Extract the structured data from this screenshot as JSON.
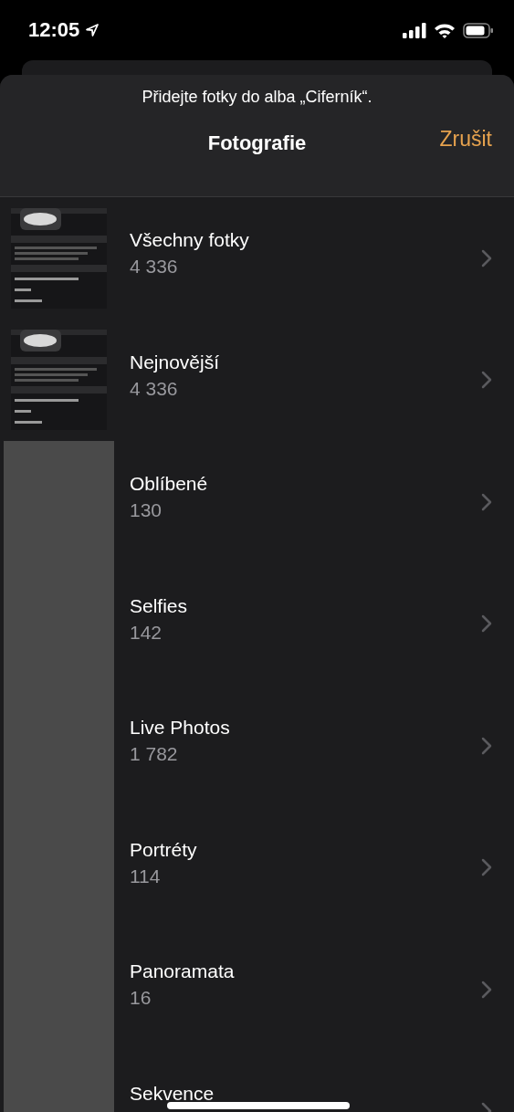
{
  "status_bar": {
    "time": "12:05"
  },
  "sheet": {
    "prompt": "Přidejte fotky do alba „Ciferník“.",
    "title": "Fotografie",
    "cancel": "Zrušit"
  },
  "albums": [
    {
      "name": "Všechny fotky",
      "count": "4 336"
    },
    {
      "name": "Nejnovější",
      "count": "4 336"
    },
    {
      "name": "Oblíbené",
      "count": "130",
      "thumbnail": {
        "kind": "placeholder"
      }
    },
    {
      "name": "Selfies",
      "count": "142",
      "thumbnail": {
        "kind": "placeholder"
      }
    },
    {
      "name": "Live Photos",
      "count": "1 782",
      "thumbnail": {
        "kind": "placeholder"
      }
    },
    {
      "name": "Portréty",
      "count": "114",
      "thumbnail": {
        "kind": "placeholder"
      }
    },
    {
      "name": "Panoramata",
      "count": "16",
      "thumbnail": {
        "kind": "placeholder"
      }
    },
    {
      "name": "Sekvence",
      "thumbnail": {
        "kind": "placeholder"
      }
    }
  ]
}
